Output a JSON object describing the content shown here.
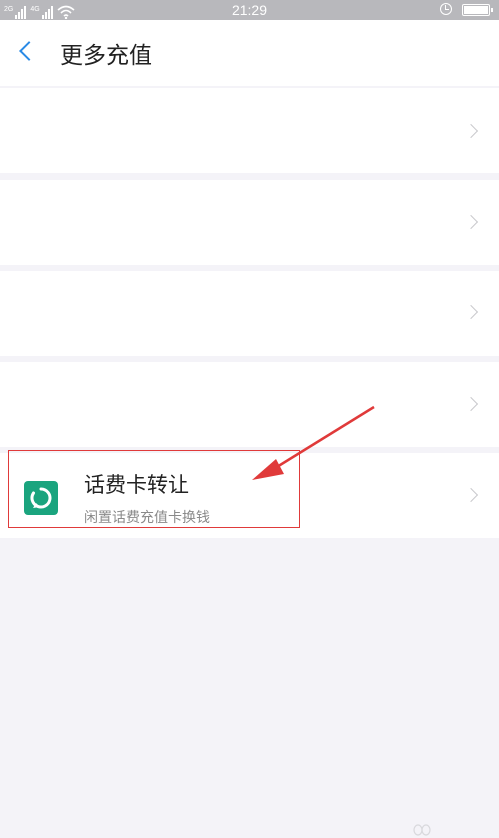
{
  "status_bar": {
    "time": "21:29",
    "network_1": "2G",
    "network_2": "4G",
    "battery_level": 1.0
  },
  "header": {
    "title": "更多充值"
  },
  "list": {
    "items": [
      {
        "title": "",
        "subtitle": ""
      },
      {
        "title": "",
        "subtitle": ""
      },
      {
        "title": "",
        "subtitle": ""
      },
      {
        "title": "",
        "subtitle": ""
      },
      {
        "title": "话费卡转让",
        "subtitle": "闲置话费充值卡换钱",
        "icon": "refresh-icon"
      }
    ]
  },
  "colors": {
    "accent": "#2a8ae6",
    "icon_green": "#1aa47e",
    "annotation_red": "#e03a3a",
    "background": "#f4f3f8"
  }
}
